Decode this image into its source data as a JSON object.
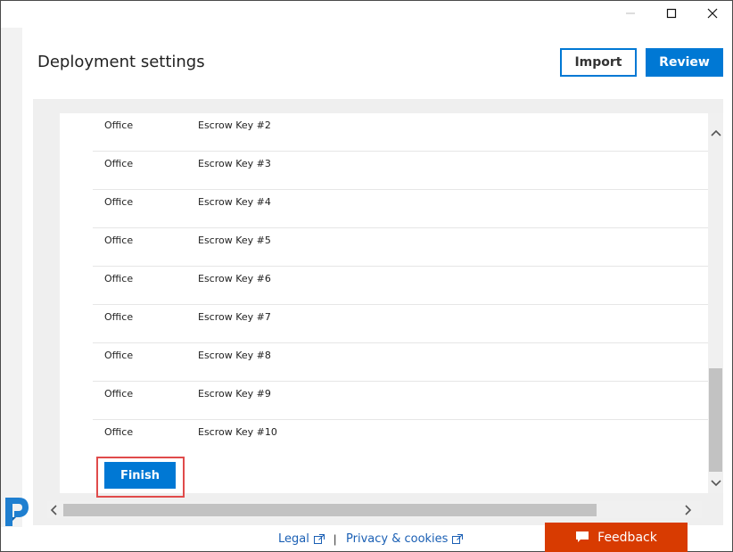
{
  "header": {
    "title": "Deployment settings",
    "import_label": "Import",
    "review_label": "Review"
  },
  "rows": [
    {
      "product": "Office",
      "name": "Escrow Key #2"
    },
    {
      "product": "Office",
      "name": "Escrow Key #3"
    },
    {
      "product": "Office",
      "name": "Escrow Key #4"
    },
    {
      "product": "Office",
      "name": "Escrow Key #5"
    },
    {
      "product": "Office",
      "name": "Escrow Key #6"
    },
    {
      "product": "Office",
      "name": "Escrow Key #7"
    },
    {
      "product": "Office",
      "name": "Escrow Key #8"
    },
    {
      "product": "Office",
      "name": "Escrow Key #9"
    },
    {
      "product": "Office",
      "name": "Escrow Key #10"
    }
  ],
  "finish_label": "Finish",
  "footer": {
    "legal_label": "Legal",
    "separator": "|",
    "privacy_label": "Privacy & cookies",
    "feedback_label": "Feedback"
  },
  "icons": {
    "minimize": "minimize-icon",
    "maximize": "maximize-icon",
    "close": "close-icon",
    "external_link": "external-link-icon",
    "feedback": "chat-bubble-icon",
    "logo": "logo-icon"
  },
  "colors": {
    "accent": "#0078d4",
    "feedback": "#d83b01",
    "highlight": "#e04b4b"
  }
}
